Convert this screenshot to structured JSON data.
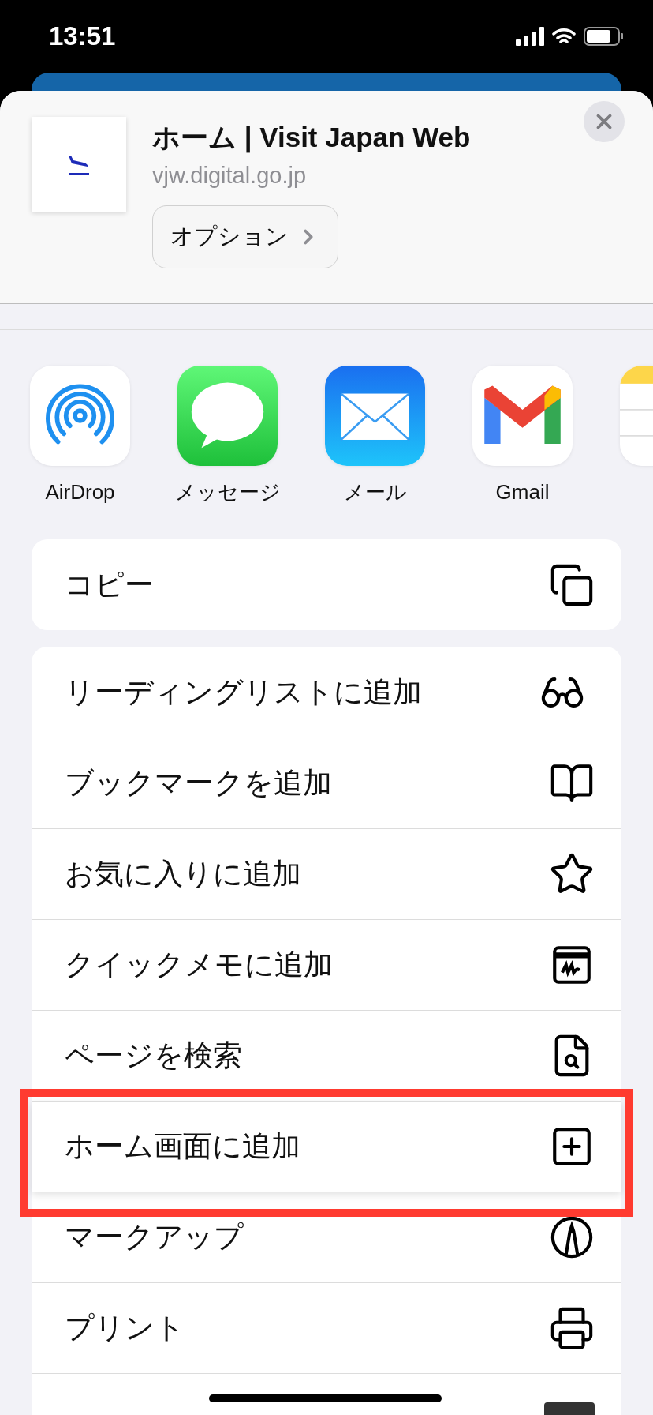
{
  "status_bar": {
    "time": "13:51"
  },
  "header": {
    "title": "ホーム | Visit Japan Web",
    "url": "vjw.digital.go.jp",
    "options_button": "オプション"
  },
  "apps": [
    {
      "kind": "airdrop",
      "label": "AirDrop"
    },
    {
      "kind": "messages",
      "label": "メッセージ"
    },
    {
      "kind": "mail",
      "label": "メール"
    },
    {
      "kind": "gmail",
      "label": "Gmail"
    },
    {
      "kind": "notes"
    }
  ],
  "copy_action": {
    "label": "コピー",
    "kind": "copy"
  },
  "actions": [
    {
      "label": "リーディングリストに追加",
      "kind": "glasses",
      "highlighted": false
    },
    {
      "label": "ブックマークを追加",
      "kind": "book",
      "highlighted": false
    },
    {
      "label": "お気に入りに追加",
      "kind": "star",
      "highlighted": false
    },
    {
      "label": "クイックメモに追加",
      "kind": "memo",
      "highlighted": false
    },
    {
      "label": "ページを検索",
      "kind": "find",
      "highlighted": false
    },
    {
      "label": "ホーム画面に追加",
      "kind": "plus",
      "highlighted": true
    },
    {
      "label": "マークアップ",
      "kind": "markup",
      "highlighted": false
    },
    {
      "label": "プリント",
      "kind": "print",
      "highlighted": false
    },
    {
      "kind": "partial",
      "highlighted": false
    }
  ]
}
